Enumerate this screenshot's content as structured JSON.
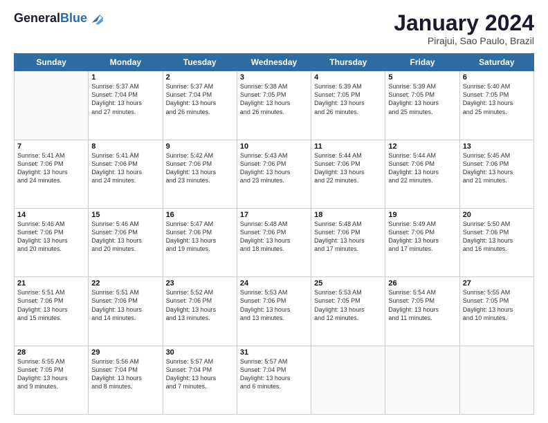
{
  "header": {
    "logo_line1": "General",
    "logo_line2": "Blue",
    "month": "January 2024",
    "location": "Pirajui, Sao Paulo, Brazil"
  },
  "weekdays": [
    "Sunday",
    "Monday",
    "Tuesday",
    "Wednesday",
    "Thursday",
    "Friday",
    "Saturday"
  ],
  "weeks": [
    [
      {
        "day": "",
        "info": ""
      },
      {
        "day": "1",
        "info": "Sunrise: 5:37 AM\nSunset: 7:04 PM\nDaylight: 13 hours\nand 27 minutes."
      },
      {
        "day": "2",
        "info": "Sunrise: 5:37 AM\nSunset: 7:04 PM\nDaylight: 13 hours\nand 26 minutes."
      },
      {
        "day": "3",
        "info": "Sunrise: 5:38 AM\nSunset: 7:05 PM\nDaylight: 13 hours\nand 26 minutes."
      },
      {
        "day": "4",
        "info": "Sunrise: 5:39 AM\nSunset: 7:05 PM\nDaylight: 13 hours\nand 26 minutes."
      },
      {
        "day": "5",
        "info": "Sunrise: 5:39 AM\nSunset: 7:05 PM\nDaylight: 13 hours\nand 25 minutes."
      },
      {
        "day": "6",
        "info": "Sunrise: 5:40 AM\nSunset: 7:05 PM\nDaylight: 13 hours\nand 25 minutes."
      }
    ],
    [
      {
        "day": "7",
        "info": "Sunrise: 5:41 AM\nSunset: 7:06 PM\nDaylight: 13 hours\nand 24 minutes."
      },
      {
        "day": "8",
        "info": "Sunrise: 5:41 AM\nSunset: 7:06 PM\nDaylight: 13 hours\nand 24 minutes."
      },
      {
        "day": "9",
        "info": "Sunrise: 5:42 AM\nSunset: 7:06 PM\nDaylight: 13 hours\nand 23 minutes."
      },
      {
        "day": "10",
        "info": "Sunrise: 5:43 AM\nSunset: 7:06 PM\nDaylight: 13 hours\nand 23 minutes."
      },
      {
        "day": "11",
        "info": "Sunrise: 5:44 AM\nSunset: 7:06 PM\nDaylight: 13 hours\nand 22 minutes."
      },
      {
        "day": "12",
        "info": "Sunrise: 5:44 AM\nSunset: 7:06 PM\nDaylight: 13 hours\nand 22 minutes."
      },
      {
        "day": "13",
        "info": "Sunrise: 5:45 AM\nSunset: 7:06 PM\nDaylight: 13 hours\nand 21 minutes."
      }
    ],
    [
      {
        "day": "14",
        "info": "Sunrise: 5:46 AM\nSunset: 7:06 PM\nDaylight: 13 hours\nand 20 minutes."
      },
      {
        "day": "15",
        "info": "Sunrise: 5:46 AM\nSunset: 7:06 PM\nDaylight: 13 hours\nand 20 minutes."
      },
      {
        "day": "16",
        "info": "Sunrise: 5:47 AM\nSunset: 7:06 PM\nDaylight: 13 hours\nand 19 minutes."
      },
      {
        "day": "17",
        "info": "Sunrise: 5:48 AM\nSunset: 7:06 PM\nDaylight: 13 hours\nand 18 minutes."
      },
      {
        "day": "18",
        "info": "Sunrise: 5:48 AM\nSunset: 7:06 PM\nDaylight: 13 hours\nand 17 minutes."
      },
      {
        "day": "19",
        "info": "Sunrise: 5:49 AM\nSunset: 7:06 PM\nDaylight: 13 hours\nand 17 minutes."
      },
      {
        "day": "20",
        "info": "Sunrise: 5:50 AM\nSunset: 7:06 PM\nDaylight: 13 hours\nand 16 minutes."
      }
    ],
    [
      {
        "day": "21",
        "info": "Sunrise: 5:51 AM\nSunset: 7:06 PM\nDaylight: 13 hours\nand 15 minutes."
      },
      {
        "day": "22",
        "info": "Sunrise: 5:51 AM\nSunset: 7:06 PM\nDaylight: 13 hours\nand 14 minutes."
      },
      {
        "day": "23",
        "info": "Sunrise: 5:52 AM\nSunset: 7:06 PM\nDaylight: 13 hours\nand 13 minutes."
      },
      {
        "day": "24",
        "info": "Sunrise: 5:53 AM\nSunset: 7:06 PM\nDaylight: 13 hours\nand 13 minutes."
      },
      {
        "day": "25",
        "info": "Sunrise: 5:53 AM\nSunset: 7:05 PM\nDaylight: 13 hours\nand 12 minutes."
      },
      {
        "day": "26",
        "info": "Sunrise: 5:54 AM\nSunset: 7:05 PM\nDaylight: 13 hours\nand 11 minutes."
      },
      {
        "day": "27",
        "info": "Sunrise: 5:55 AM\nSunset: 7:05 PM\nDaylight: 13 hours\nand 10 minutes."
      }
    ],
    [
      {
        "day": "28",
        "info": "Sunrise: 5:55 AM\nSunset: 7:05 PM\nDaylight: 13 hours\nand 9 minutes."
      },
      {
        "day": "29",
        "info": "Sunrise: 5:56 AM\nSunset: 7:04 PM\nDaylight: 13 hours\nand 8 minutes."
      },
      {
        "day": "30",
        "info": "Sunrise: 5:57 AM\nSunset: 7:04 PM\nDaylight: 13 hours\nand 7 minutes."
      },
      {
        "day": "31",
        "info": "Sunrise: 5:57 AM\nSunset: 7:04 PM\nDaylight: 13 hours\nand 6 minutes."
      },
      {
        "day": "",
        "info": ""
      },
      {
        "day": "",
        "info": ""
      },
      {
        "day": "",
        "info": ""
      }
    ]
  ]
}
